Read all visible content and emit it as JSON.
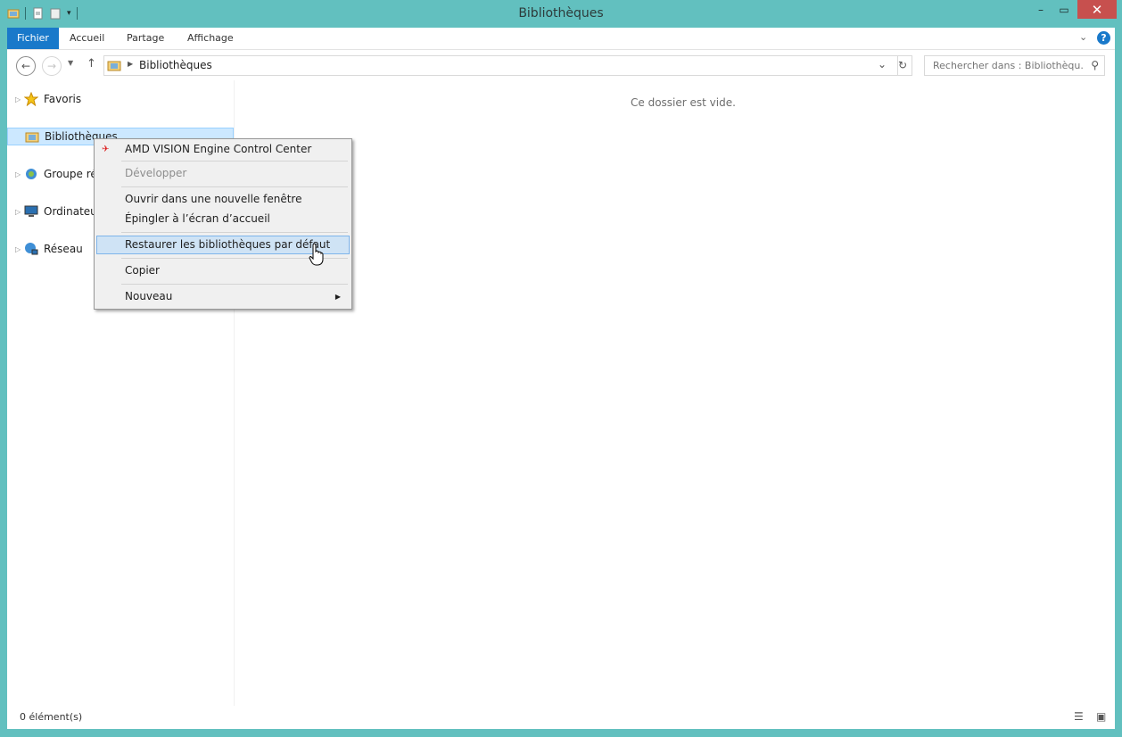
{
  "window": {
    "title": "Bibliothèques"
  },
  "ribbon": {
    "tabs": [
      "Fichier",
      "Accueil",
      "Partage",
      "Affichage"
    ]
  },
  "address": {
    "crumb": "Bibliothèques",
    "search_placeholder": "Rechercher dans : Bibliothèqu..."
  },
  "nav": {
    "items": [
      "Favoris",
      "Bibliothèques",
      "Groupe rés",
      "Ordinateur",
      "Réseau"
    ]
  },
  "main": {
    "empty_text": "Ce dossier est vide."
  },
  "status": {
    "count": "0 élément(s)"
  },
  "context_menu": {
    "items": [
      "AMD  VISION  Engine  Control  Center",
      "Développer",
      "Ouvrir dans une nouvelle fenêtre",
      "Épingler à l’écran d’accueil",
      "Restaurer les bibliothèques par défaut",
      "Copier",
      "Nouveau"
    ]
  },
  "colors": {
    "frame": "#62c0bf",
    "file_tab": "#1979ca",
    "close": "#c7504e",
    "selection": "#cce8ff",
    "menu_highlight": "#cfe3f5"
  }
}
